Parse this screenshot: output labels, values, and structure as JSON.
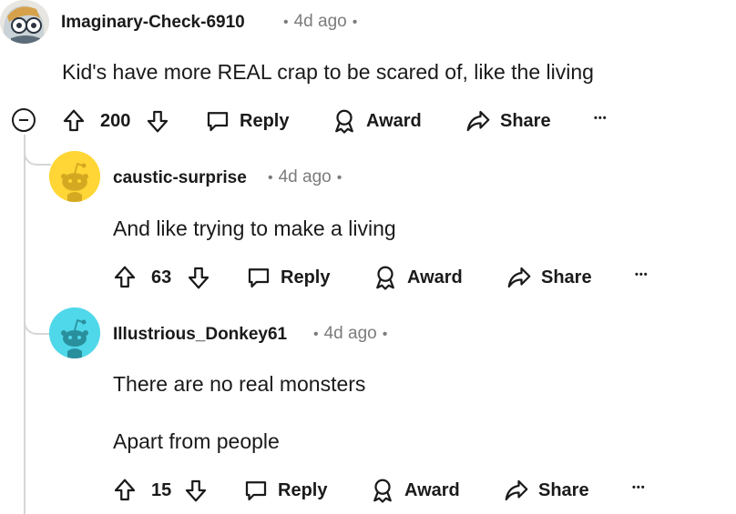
{
  "comments": [
    {
      "username": "Imaginary-Check-6910",
      "time": "4d ago",
      "text_lines": [
        "Kid's have more REAL crap to be scared of, like the living"
      ],
      "score": "200",
      "actions": {
        "reply": "Reply",
        "award": "Award",
        "share": "Share",
        "more": "•••"
      },
      "avatar": {
        "bg": "#e8e6e1",
        "type": "custom"
      }
    },
    {
      "username": "caustic-surprise",
      "time": "4d ago",
      "text_lines": [
        "And like trying to make a living"
      ],
      "score": "63",
      "actions": {
        "reply": "Reply",
        "award": "Award",
        "share": "Share",
        "more": "•••"
      },
      "avatar": {
        "bg": "#ffd635",
        "type": "snoo"
      }
    },
    {
      "username": "Illustrious_Donkey61",
      "time": "4d ago",
      "text_lines": [
        "There are no real monsters",
        "Apart from people"
      ],
      "score": "15",
      "actions": {
        "reply": "Reply",
        "award": "Award",
        "share": "Share",
        "more": "•••"
      },
      "avatar": {
        "bg": "#4fd8ea",
        "type": "snoo"
      }
    }
  ],
  "colors": {
    "text": "#1a1a1b",
    "meta": "#7c7c7c",
    "thread_line": "#d6d6d6"
  }
}
